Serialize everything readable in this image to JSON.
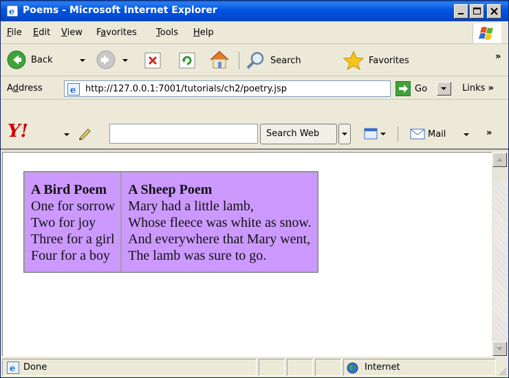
{
  "window": {
    "title": "Poems - Microsoft Internet Explorer"
  },
  "menu": {
    "items": [
      {
        "label": "File",
        "accel": "F"
      },
      {
        "label": "Edit",
        "accel": "E"
      },
      {
        "label": "View",
        "accel": "V"
      },
      {
        "label": "Favorites",
        "accel": "a"
      },
      {
        "label": "Tools",
        "accel": "T"
      },
      {
        "label": "Help",
        "accel": "H"
      }
    ]
  },
  "toolbar": {
    "back_label": "Back",
    "search_label": "Search",
    "favorites_label": "Favorites",
    "overflow": "»"
  },
  "address": {
    "label": "Address",
    "url": "http://127.0.0.1:7001/tutorials/ch2/poetry.jsp",
    "go_label": "Go",
    "links_label": "Links",
    "links_overflow": "»"
  },
  "yahoo": {
    "logo": "Y!",
    "search_value": "",
    "search_button": "Search Web",
    "mail_label": "Mail",
    "overflow": "»"
  },
  "content": {
    "table": {
      "bg_color": "#cc99ff",
      "columns": [
        {
          "title": "A Bird Poem",
          "lines": [
            "One for sorrow",
            "Two for joy",
            "Three for a girl",
            "Four for a boy"
          ]
        },
        {
          "title": "A Sheep Poem",
          "lines": [
            "Mary had a little lamb,",
            "Whose fleece was white as snow.",
            "And everywhere that Mary went,",
            "The lamb was sure to go."
          ]
        }
      ]
    }
  },
  "status": {
    "text": "Done",
    "zone": "Internet"
  },
  "colors": {
    "titlebar": "#0054e3",
    "chrome": "#ece9d8",
    "table_bg": "#cc99ff"
  }
}
